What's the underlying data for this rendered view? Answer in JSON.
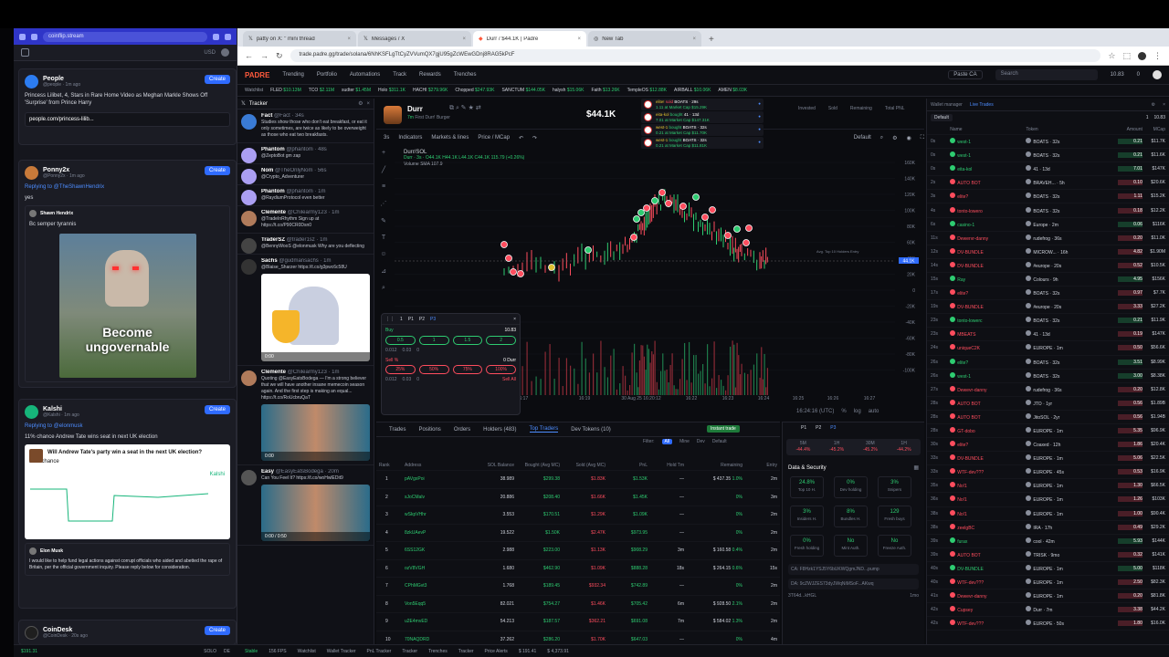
{
  "left_window": {
    "url": "coinflip.stream",
    "feed": [
      {
        "name": "People",
        "handle": "@people · 1m ago",
        "text": "Princess Lilibet, 4, Stars in Rare Home Video as Meghan Markle Shows Off 'Surprise' from Prince Harry",
        "link": "people.com/princess-lilib...",
        "color": "#2c7cf0"
      },
      {
        "name": "Ponny2x",
        "handle": "@Ponny2x · 1m ago",
        "reply": "Replying to @TheShawnHendrix",
        "text": "yes",
        "quote_name": "Shawn Hendrix",
        "quote_text": "Bc semper tyrannis",
        "meme_text": "Become ungovernable",
        "color": "#c87a3a"
      },
      {
        "name": "Kalshi",
        "handle": "@Kalshi · 1m ago",
        "reply": "Replying to @elonmusk",
        "text": "11% chance Andrew Tate wins seat in next UK election",
        "poll_title": "Will Andrew Tate's party win a seat in the next UK election?",
        "poll_pct": "11%",
        "poll_label": "chance",
        "brand": "Kalshi",
        "quote_name": "Elon Musk",
        "quote_text": "I would like to help fund legal actions against corrupt officials who aided and abetted the rape of Britain, per the official government inquiry. Please reply below for consideration.",
        "color": "#16b57a"
      },
      {
        "name": "CoinDesk",
        "handle": "@CoinDesk · 20s ago",
        "color": "#1f1f1f"
      }
    ],
    "create_label": "Create",
    "status": {
      "price": "$191.31",
      "ticker": "SOLO",
      "badge": "DE"
    }
  },
  "tabs": [
    {
      "label": "patty on X: \" mini thread",
      "active": false
    },
    {
      "label": "Messages / X",
      "active": false
    },
    {
      "label": "Durr / $44.1K | Padre",
      "active": true
    },
    {
      "label": "New Tab",
      "active": false
    }
  ],
  "address": "trade.padre.gg/trade/solana/6NhKSFLgTtCyZVVumQX7gjU95gZcWEwGDnj8RAG5kPcF",
  "app": {
    "logo": "PADRE",
    "nav": [
      "Trending",
      "Portfolio",
      "Automations",
      "Track",
      "Rewards",
      "Trenches"
    ],
    "paste_ca": "Paste CA",
    "search": "Search",
    "balance": "10.83",
    "count": "0"
  },
  "watchlist": {
    "label": "Watchlist",
    "items": [
      {
        "name": "FLED",
        "value": "$10.13M"
      },
      {
        "name": "TCO",
        "value": "$2.11M"
      },
      {
        "name": "sudter",
        "value": "$1.45M"
      },
      {
        "name": "Holo",
        "value": "$311.1K"
      },
      {
        "name": "HACHI",
        "value": "$279.96K"
      },
      {
        "name": "Chopped",
        "value": "$247.93K"
      },
      {
        "name": "SANCTUM",
        "value": "$144.05K"
      },
      {
        "name": "halysh",
        "value": "$15.06K"
      },
      {
        "name": "Faith",
        "value": "$13.26K"
      },
      {
        "name": "TempleOS",
        "value": "$12.88K"
      },
      {
        "name": "AIRBALL",
        "value": "$10.06K"
      },
      {
        "name": "AMEN",
        "value": "$8.03K"
      }
    ]
  },
  "tracker": {
    "title": "Tracker",
    "posts": [
      {
        "name": "Fact",
        "handle": "@Fact · 34s",
        "text": "Studies show those who don't eat breakfast, or eat it only sometimes, are twice as likely to be overweight as those who eat two breakfasts.",
        "color": "#3a7bd5"
      },
      {
        "name": "Phantom",
        "handle": "@phantom · 48s",
        "text": "@ZeptoBot gm zap",
        "color": "#ab9ff2"
      },
      {
        "name": "Nom",
        "handle": "@TheOnlyNom · 56s",
        "text": "@Crypto_Adventurer",
        "color": "#ab9ff2"
      },
      {
        "name": "Phantom",
        "handle": "@phantom · 1m",
        "text": "@RaydiumProtocol even better",
        "color": "#ab9ff2"
      },
      {
        "name": "Clemente",
        "handle": "@Chilearmy123 · 1m",
        "text": "@TradeInRhythm Sign up at https://t.co/P90CR0Dsn0",
        "color": "#b07b5b"
      },
      {
        "name": "TraderSZ",
        "handle": "@trader1sz · 1m",
        "text": "@BennyWooS @elonmusk Why are you deflecting",
        "color": "#444"
      },
      {
        "name": "Sachs",
        "handle": "@gudmansachs · 1m",
        "text": "@Blaise_Sharzer https://t.co/g3pwc6c58U",
        "color": "#333"
      },
      {
        "name": "Clemente",
        "handle": "@Chilearmy123 · 1m",
        "text": "Quoting @EasyEatsBodega — I'm a strong believer that we will have another insane memecoin season again. And the first step is making an equal... https://t.co/RoUcbruQaT",
        "color": "#b07b5b"
      },
      {
        "name": "Easy",
        "handle": "@EasyEatsBodega · 20m",
        "text": "Can You Feel It? https://t.co/woHwlEDit9",
        "color": "#555"
      }
    ],
    "video_time1": "0:00",
    "video_time2": "0:00",
    "video_time3": "0:00 / 0:50"
  },
  "token": {
    "name": "Durr",
    "subtitle": "First Durr! Burger",
    "age": "7m",
    "price": "$44.1K",
    "pair": "Durr/SOL",
    "interval": "3s",
    "ohlc": "Durr · 3s · O44.1K H44.1K L44.1K C44.1K 115.79 (+0.26%)",
    "volume": "Volume SMA 107.9",
    "toolbar": [
      "Indicators",
      "Markets & lines",
      "Price / MCap"
    ],
    "default_label": "Default",
    "hdr_stats": [
      {
        "label": "Invested",
        "value": ""
      },
      {
        "label": "Sold",
        "value": ""
      },
      {
        "label": "Remaining",
        "value": ""
      },
      {
        "label": "Total PNL",
        "value": ""
      }
    ],
    "time_axis": [
      "16:17",
      "16:19",
      "30 Aug 25 16:20:12",
      "16:22",
      "16:23",
      "16:24",
      "16:25",
      "16:26",
      "16:27"
    ],
    "price_axis": [
      "160K",
      "140K",
      "120K",
      "100K",
      "80K",
      "60K",
      "40K",
      "20K",
      "0",
      "-20K",
      "-40K",
      "-60K",
      "-80K",
      "-100K"
    ],
    "current_label": "44.1K",
    "avg_label": "Avg. Top 10 Holders Entry",
    "clock": "16:24:16 (UTC)",
    "scale_opts": [
      "%",
      "log",
      "auto"
    ]
  },
  "notifications": [
    {
      "who": "elite!",
      "action": "sold",
      "token": "BOATS",
      "age": "29s",
      "detail": "1.11 at Market Cap $15.29K"
    },
    {
      "who": "eita-kol",
      "action": "bought",
      "token": "41",
      "age": "13d",
      "detail": "7.01 at Market Cap $147.31K"
    },
    {
      "who": "west-1",
      "action": "bought",
      "token": "BOATS",
      "age": "32s",
      "detail": "0.21 at Market Cap $11.70K"
    },
    {
      "who": "west-1",
      "action": "bought",
      "token": "BOATS",
      "age": "32s",
      "detail": "0.21 at Market Cap $11.81K"
    }
  ],
  "trade_panel": {
    "buy_label": "Buy",
    "sell_label": "Sell %",
    "balance": "10.83",
    "buy_amounts": [
      "0.5",
      "1",
      "1.5",
      "2"
    ],
    "sell_amounts": [
      "25%",
      "50%",
      "75%",
      "100%"
    ],
    "held": "0 Durr",
    "sell_all": "Sell All",
    "presets": [
      "P1",
      "P2",
      "P3"
    ],
    "fee_a": "0.012",
    "fee_b": "0.03",
    "fee_c": "0"
  },
  "holders": {
    "tabs": [
      "Trades",
      "Positions",
      "Orders",
      "Holders (483)",
      "Top Traders",
      "Dev Tokens (10)"
    ],
    "active_tab": "Top Traders",
    "instant": "Instant trade",
    "filter": "Filter:",
    "filter_opts": [
      "All",
      "Mine",
      "Dev",
      "Default"
    ],
    "columns": [
      "Rank",
      "Address",
      "SOL Balance",
      "Bought (Avg MC)",
      "Sold (Avg MC)",
      "PnL",
      "Hold Tm",
      "Remaining",
      "Entry"
    ],
    "rows": [
      {
        "rank": "1",
        "addr": "pAVgxPoi",
        "bal": "38.989",
        "bought": "$299.38",
        "sold": "$1.83K",
        "pnl": "$1.53K",
        "hold": "—",
        "rem": "$ 437.35",
        "pct": "1.0%",
        "entry": "2m"
      },
      {
        "rank": "2",
        "addr": "sJoCMalv",
        "bal": "20.886",
        "bought": "$208.40",
        "sold": "$1.66K",
        "pnl": "$1.45K",
        "hold": "—",
        "rem": "",
        "pct": "0%",
        "entry": "3m"
      },
      {
        "rank": "3",
        "addr": "wSkpVHhr",
        "bal": "3.553",
        "bought": "$170.51",
        "sold": "$1.29K",
        "pnl": "$1.09K",
        "hold": "—",
        "rem": "",
        "pct": "0%",
        "entry": "2m"
      },
      {
        "rank": "4",
        "addr": "8zkUAevP",
        "bal": "19.522",
        "bought": "$1.50K",
        "sold": "$2.47K",
        "pnl": "$973.95",
        "hold": "—",
        "rem": "",
        "pct": "0%",
        "entry": "2m"
      },
      {
        "rank": "5",
        "addr": "6SS12GK",
        "bal": "2.988",
        "bought": "$223.00",
        "sold": "$1.13K",
        "pnl": "$908.29",
        "hold": "3m",
        "rem": "$ 160.58",
        "pct": "0.4%",
        "entry": "2m"
      },
      {
        "rank": "6",
        "addr": "ozV8VGH",
        "bal": "1.680",
        "bought": "$462.90",
        "sold": "$1.09K",
        "pnl": "$888.28",
        "hold": "18s",
        "rem": "$ 264.15",
        "pct": "0.6%",
        "entry": "15s"
      },
      {
        "rank": "7",
        "addr": "CPhMGvt3",
        "bal": "1.768",
        "bought": "$189.45",
        "sold": "$932.34",
        "pnl": "$742.89",
        "hold": "—",
        "rem": "",
        "pct": "0%",
        "entry": "2m"
      },
      {
        "rank": "8",
        "addr": "Von5Eqq5",
        "bal": "82.021",
        "bought": "$754.27",
        "sold": "$1.46K",
        "pnl": "$705.42",
        "hold": "6m",
        "rem": "$ 928.50",
        "pct": "2.1%",
        "entry": "2m"
      },
      {
        "rank": "9",
        "addr": "u2E4mvED",
        "bal": "54.213",
        "bought": "$187.57",
        "sold": "$362.21",
        "pnl": "$691.08",
        "hold": "7m",
        "rem": "$ 584.02",
        "pct": "1.3%",
        "entry": "2m"
      },
      {
        "rank": "10",
        "addr": "70NAQDRD",
        "bal": "37.262",
        "bought": "$286.20",
        "sold": "$1.70K",
        "pnl": "$647.03",
        "hold": "—",
        "rem": "",
        "pct": "0%",
        "entry": "4m"
      }
    ]
  },
  "security": {
    "presets": [
      "P1",
      "P2",
      "P3"
    ],
    "periods": [
      {
        "label": "5M",
        "value": "-44.4%"
      },
      {
        "label": "1H",
        "value": "-45.2%"
      },
      {
        "label": "30M",
        "value": "-45.2%"
      },
      {
        "label": "1H",
        "value": "-44.2%"
      }
    ],
    "title": "Data & Security",
    "cells": [
      {
        "value": "24.8%",
        "label": "Top 10 H."
      },
      {
        "value": "0%",
        "label": "Dev holding"
      },
      {
        "value": "3%",
        "label": "Snipers"
      },
      {
        "value": "3%",
        "label": "Insiders H."
      },
      {
        "value": "8%",
        "label": "Bundles H."
      },
      {
        "value": "129",
        "label": "Fresh buys"
      },
      {
        "value": "0%",
        "label": "Fresh holding"
      },
      {
        "value": "No",
        "label": "Mint Auth."
      },
      {
        "value": "No",
        "label": "Freeze Auth."
      }
    ],
    "ca": "CA: F8Hzk1YSJ5Y6bUKWQgmJND...pump",
    "dev": "DA: 9cZWJZES73dyJWqNiMSoF...AKwq",
    "dev2": "3T64d...kHGL",
    "dev_age": "1mo"
  },
  "wallet": {
    "title": "Wallet manager",
    "tab2": "Live Trades",
    "default": "Default",
    "count": "1",
    "balance": "10.83",
    "columns": [
      "Name",
      "Token",
      "Amount",
      "MCap"
    ],
    "rows": [
      {
        "t": "0s",
        "name": "west-1",
        "token": "BOATS · 32s",
        "amt": "0.21",
        "mc": "$11.7K",
        "buy": true
      },
      {
        "t": "0s",
        "name": "west-1",
        "token": "BOATS · 32s",
        "amt": "0.21",
        "mc": "$11.6K",
        "buy": true
      },
      {
        "t": "0s",
        "name": "eita-kol",
        "token": "41 · 13d",
        "amt": "7.01",
        "mc": "$147K",
        "buy": true
      },
      {
        "t": "2s",
        "name": "AUTO BOT",
        "token": "BRAVEH... · 5h",
        "amt": "0.10",
        "mc": "$20.6K",
        "buy": false
      },
      {
        "t": "3s",
        "name": "elite?",
        "token": "BOATS · 32s",
        "amt": "1.11",
        "mc": "$15.2K",
        "buy": false
      },
      {
        "t": "4s",
        "name": "tonto-lowero",
        "token": "BOATS · 32s",
        "amt": "0.18",
        "mc": "$12.2K",
        "buy": false
      },
      {
        "t": "6s",
        "name": "casino-1",
        "token": "Europe · 2m",
        "amt": "0.06",
        "mc": "$116K",
        "buy": true
      },
      {
        "t": "11s",
        "name": "Dewervr-danny",
        "token": "rudefrog · 36s",
        "amt": "0.20",
        "mc": "$11.0K",
        "buy": false
      },
      {
        "t": "12s",
        "name": "DV-BUNDLE",
        "token": "MICROW... · 16h",
        "amt": "4.82",
        "mc": "$1.90M",
        "buy": false
      },
      {
        "t": "14s",
        "name": "DV-BUNDLE",
        "token": "#europe · 20s",
        "amt": "0.52",
        "mc": "$10.5K",
        "buy": false
      },
      {
        "t": "15s",
        "name": "Ray",
        "token": "Colours · 9h",
        "amt": "4.95",
        "mc": "$156K",
        "buy": true
      },
      {
        "t": "17s",
        "name": "elite?",
        "token": "BOATS · 32s",
        "amt": "0.97",
        "mc": "$7.7K",
        "buy": false
      },
      {
        "t": "19s",
        "name": "DV-BUNDLE",
        "token": "#europe · 20s",
        "amt": "3.33",
        "mc": "$27.2K",
        "buy": false
      },
      {
        "t": "23s",
        "name": "tonto-lowerc",
        "token": "BOATS · 32s",
        "amt": "0.21",
        "mc": "$11.9K",
        "buy": true
      },
      {
        "t": "23s",
        "name": "MBEATS",
        "token": "41 · 13d",
        "amt": "0.19",
        "mc": "$147K",
        "buy": false
      },
      {
        "t": "24s",
        "name": "uniqueC2K",
        "token": "EUROPE · 1m",
        "amt": "0.50",
        "mc": "$56.6K",
        "buy": false
      },
      {
        "t": "26s",
        "name": "elite?",
        "token": "BOATS · 32s",
        "amt": "3.51",
        "mc": "$8.99K",
        "buy": true
      },
      {
        "t": "26s",
        "name": "west-1",
        "token": "BOATS · 32s",
        "amt": "3.00",
        "mc": "$8.38K",
        "buy": true
      },
      {
        "t": "27s",
        "name": "Dewevr-danny",
        "token": "rudefrog · 36s",
        "amt": "0.20",
        "mc": "$12.8K",
        "buy": false
      },
      {
        "t": "28s",
        "name": "AUTO BOT",
        "token": "JTO · 1yr",
        "amt": "0.56",
        "mc": "$1.89B",
        "buy": false
      },
      {
        "t": "28s",
        "name": "AUTO BOT",
        "token": "JitoSOL · 2yr",
        "amt": "0.56",
        "mc": "$1.94B",
        "buy": false
      },
      {
        "t": "28s",
        "name": "GT-dobo",
        "token": "EUROPE · 1m",
        "amt": "5.35",
        "mc": "$96.9K",
        "buy": false
      },
      {
        "t": "30s",
        "name": "elite?",
        "token": "Coaxed · 12h",
        "amt": "1.86",
        "mc": "$20.4K",
        "buy": false
      },
      {
        "t": "33s",
        "name": "DV-BUNDLE",
        "token": "EUROPE · 1m",
        "amt": "5.06",
        "mc": "$22.5K",
        "buy": false
      },
      {
        "t": "33s",
        "name": "WTF-dev???",
        "token": "EUROPE · 45s",
        "amt": "0.53",
        "mc": "$16.9K",
        "buy": false
      },
      {
        "t": "35s",
        "name": "No!1",
        "token": "EUROPE · 1m",
        "amt": "1.30",
        "mc": "$66.5K",
        "buy": false
      },
      {
        "t": "36s",
        "name": "No!1",
        "token": "EUROPE · 1m",
        "amt": "1.26",
        "mc": "$103K",
        "buy": false
      },
      {
        "t": "38s",
        "name": "No!1",
        "token": "EUROPE · 1m",
        "amt": "1.00",
        "mc": "$90.4K",
        "buy": false
      },
      {
        "t": "38s",
        "name": "zeelgBC",
        "token": "IRA · 17h",
        "amt": "0.49",
        "mc": "$29.2K",
        "buy": false
      },
      {
        "t": "39s",
        "name": "furax",
        "token": "cool · 42m",
        "amt": "5.93",
        "mc": "$144K",
        "buy": true
      },
      {
        "t": "39s",
        "name": "AUTO BOT",
        "token": "TRISK · 9mo",
        "amt": "0.32",
        "mc": "$141K",
        "buy": false
      },
      {
        "t": "40s",
        "name": "DV-BUNDLE",
        "token": "EUROPE · 1m",
        "amt": "5.00",
        "mc": "$118K",
        "buy": true
      },
      {
        "t": "40s",
        "name": "WTF-dev???",
        "token": "EUROPE · 1m",
        "amt": "2.50",
        "mc": "$82.3K",
        "buy": false
      },
      {
        "t": "41s",
        "name": "Dewevr-danny",
        "token": "EUROPE · 1m",
        "amt": "0.20",
        "mc": "$81.8K",
        "buy": false
      },
      {
        "t": "42s",
        "name": "Cupsey",
        "token": "Durr · 7m",
        "amt": "3.38",
        "mc": "$44.2K",
        "buy": false
      },
      {
        "t": "42s",
        "name": "WTF-dev???",
        "token": "EUROPE · 50s",
        "amt": "1.80",
        "mc": "$16.0K",
        "buy": false
      }
    ]
  },
  "status_bar": [
    "Stable",
    "156 FPS",
    "Watchlist",
    "Wallet Tracker",
    "PnL Tracker",
    "Tracker",
    "Trenches",
    "Tracker",
    "Price Alerts",
    "$ 191.41",
    "$ 4,373.91"
  ],
  "colors": {
    "accent": "#2f6bff",
    "buy": "#2ecc71",
    "sell": "#ff4d5e",
    "brand": "#ff5a3c"
  }
}
